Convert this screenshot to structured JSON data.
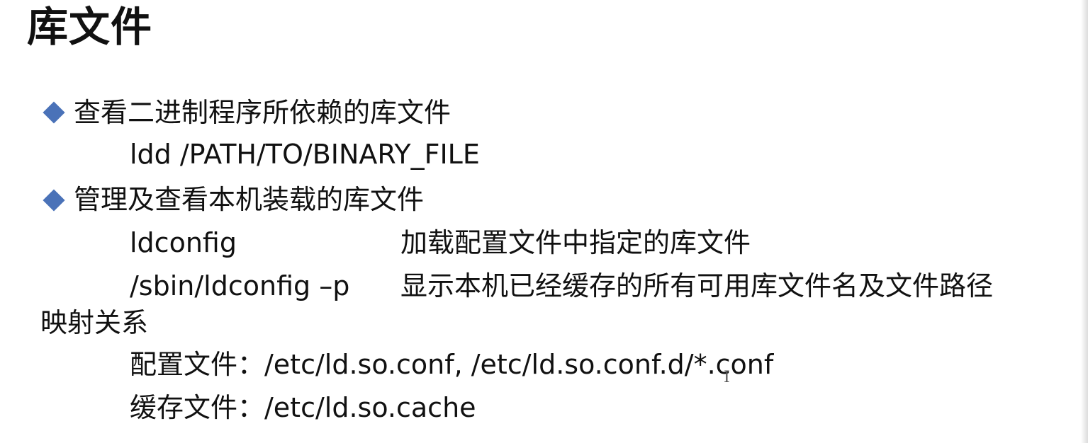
{
  "slide": {
    "title": "库文件",
    "items": [
      {
        "bullet": "查看二进制程序所依赖的库文件"
      },
      {
        "command": "ldd /PATH/TO/BINARY_FILE"
      },
      {
        "bullet": "管理及查看本机装载的库文件"
      },
      {
        "command": "ldconfig",
        "description": "加载配置文件中指定的库文件"
      },
      {
        "command": "/sbin/ldconfig –p",
        "description": "显示本机已经缓存的所有可用库文件名及文件路径"
      },
      {
        "continuation": "映射关系"
      },
      {
        "text": "配置文件：/etc/ld.so.conf, /etc/ld.so.conf.d/*.conf"
      },
      {
        "text": "缓存文件：/etc/ld.so.cache"
      }
    ]
  },
  "colors": {
    "bullet": "#4a72b8",
    "text": "#111111",
    "background": "#ffffff"
  },
  "icons": {
    "bullet": "diamond-bullet-icon",
    "cursor": "text-cursor-icon"
  }
}
